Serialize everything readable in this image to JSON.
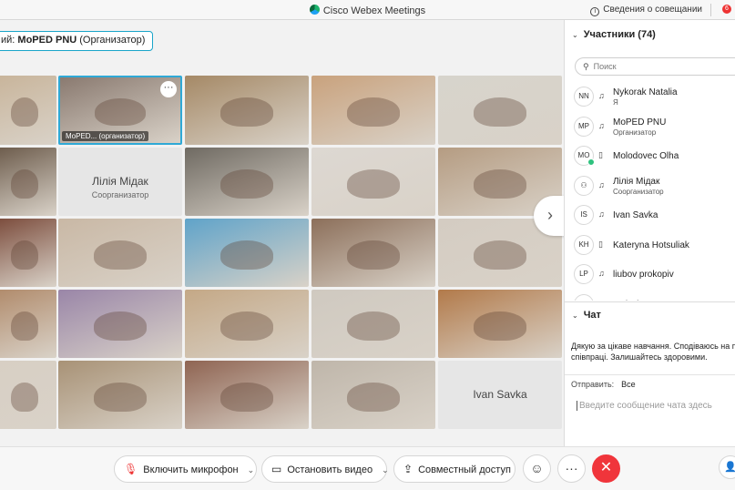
{
  "window": {
    "title": "Cisco Webex Meetings",
    "meeting_info": "Сведения о совещании",
    "notification_count": "6"
  },
  "speaker_tag": {
    "prefix": "ий:",
    "name": "MoPED PNU",
    "role": "(Организатор)"
  },
  "tiles": [
    {
      "label": "",
      "bg": "#c8b49a"
    },
    {
      "label": "MoPED...     (организатор)",
      "bg": "#8a7a70",
      "active": true
    },
    {
      "label": "",
      "bg": "#a58966"
    },
    {
      "label": "",
      "bg": "#c9a27d"
    },
    {
      "label": "",
      "bg": "#d7d4cc"
    },
    {
      "label": "",
      "bg": "#6b5a4a"
    },
    {
      "name": "Лілія Мідак",
      "role": "Соорганизатор"
    },
    {
      "label": "",
      "bg": "#6f6a62"
    },
    {
      "label": "",
      "bg": "#ddd8d2"
    },
    {
      "label": "",
      "bg": "#b59c82"
    },
    {
      "label": "",
      "bg": "#7a4a3a"
    },
    {
      "label": "",
      "bg": "#c9b8a5"
    },
    {
      "label": "",
      "bg": "#5fa3c9"
    },
    {
      "label": "",
      "bg": "#8c6f5a"
    },
    {
      "label": "",
      "bg": "#d4ccc2"
    },
    {
      "label": "",
      "bg": "#b08a6a"
    },
    {
      "label": "",
      "bg": "#9a86a8"
    },
    {
      "label": "",
      "bg": "#c4a886"
    },
    {
      "label": "",
      "bg": "#cfc9c0"
    },
    {
      "label": "",
      "bg": "#b27a4a"
    },
    {
      "label": "",
      "bg": "#d8cfc4"
    },
    {
      "label": "",
      "bg": "#a89276"
    },
    {
      "label": "",
      "bg": "#8f6452"
    },
    {
      "label": "",
      "bg": "#bfb6aa"
    },
    {
      "name": "Ivan Savka",
      "role": ""
    }
  ],
  "controls": {
    "mic": "Включить микрофон",
    "video": "Остановить видео",
    "share": "Совместный доступ",
    "more": "···"
  },
  "participants": {
    "title": "Участники (74)",
    "search_placeholder": "Поиск",
    "items": [
      {
        "initials": "NN",
        "name": "Nykorak Natalia",
        "role": "Я",
        "icon": "headset"
      },
      {
        "initials": "MP",
        "name": "MoPED PNU",
        "role": "Организатор",
        "icon": "headset"
      },
      {
        "initials": "MO",
        "name": "Molodovec Olha",
        "role": "",
        "icon": "phone",
        "online": true
      },
      {
        "initials": "",
        "name": "Лілія Мідак",
        "role": "Соорганизатор",
        "icon": "headset"
      },
      {
        "initials": "IS",
        "name": "Ivan Savka",
        "role": "",
        "icon": "headset"
      },
      {
        "initials": "KH",
        "name": "Kateryna Hotsuliak",
        "role": "",
        "icon": "phone"
      },
      {
        "initials": "LP",
        "name": "liubov prokopiv",
        "role": "",
        "icon": "headset"
      },
      {
        "initials": "MI",
        "name": "Malysh Iryna",
        "role": "",
        "icon": "headset"
      }
    ]
  },
  "chat": {
    "title": "Чат",
    "message": "Дякую за цікаве навчання. Сподіваюсь на п співпраці. Залишайтесь здоровими.",
    "send_to_label": "Отправить:",
    "send_to_value": "Все",
    "input_placeholder": "Введите сообщение чата здесь"
  }
}
